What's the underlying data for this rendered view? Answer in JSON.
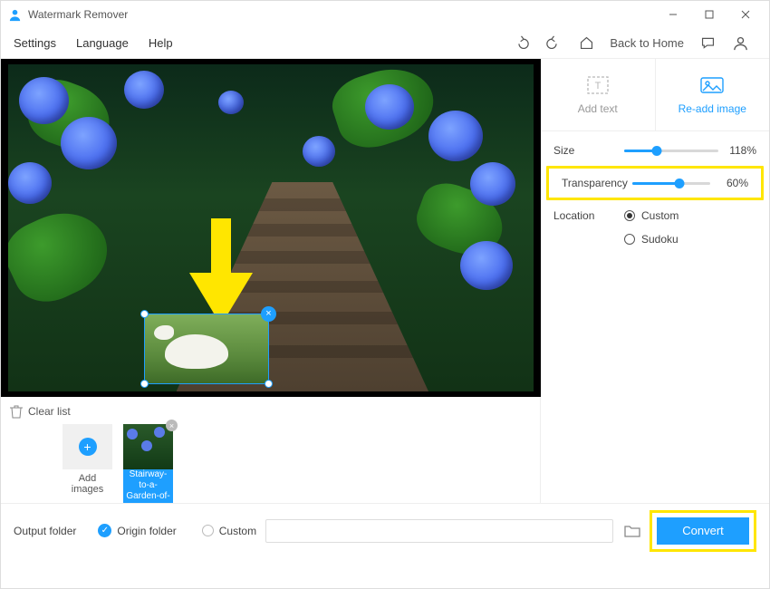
{
  "titlebar": {
    "app_name": "Watermark Remover"
  },
  "menubar": {
    "settings": "Settings",
    "language": "Language",
    "help": "Help",
    "back_home": "Back to Home"
  },
  "side_panel": {
    "tab_add_text": "Add text",
    "tab_readd_image": "Re-add image",
    "size_label": "Size",
    "size_value": "118%",
    "size_percent": 35,
    "transparency_label": "Transparency",
    "transparency_value": "60%",
    "transparency_percent": 60,
    "location_label": "Location",
    "loc_custom": "Custom",
    "loc_sudoku": "Sudoku"
  },
  "thumbs": {
    "clear_list": "Clear list",
    "add_images": "Add images",
    "item1_caption": "Stairway-to-a-Garden-of-"
  },
  "footer": {
    "output_folder": "Output folder",
    "origin_folder": "Origin folder",
    "custom": "Custom",
    "convert": "Convert"
  }
}
